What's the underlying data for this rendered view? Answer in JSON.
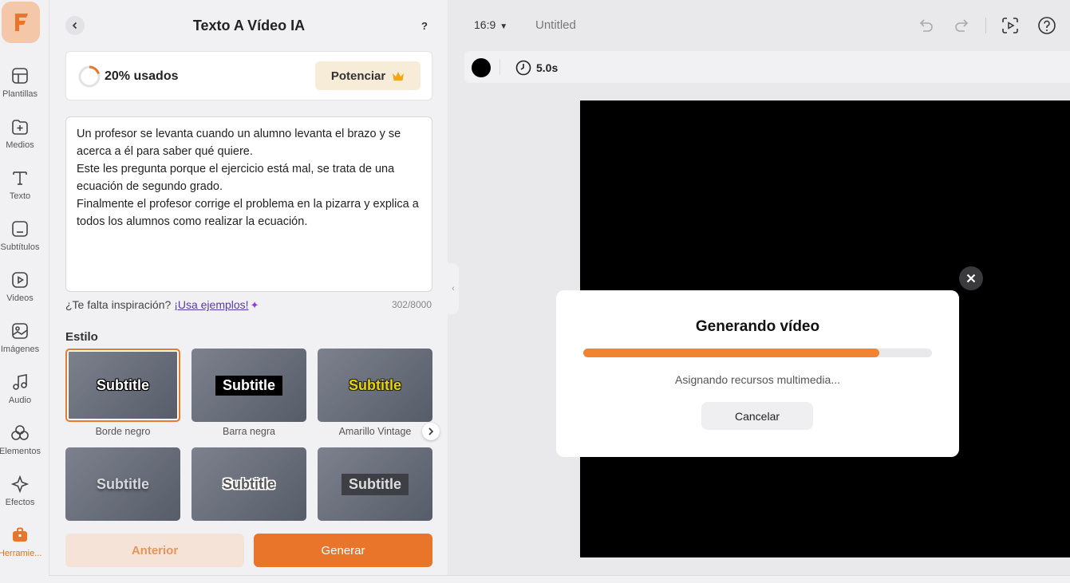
{
  "nav": {
    "items": [
      {
        "label": "Plantillas",
        "icon": "templates-icon"
      },
      {
        "label": "Medios",
        "icon": "media-icon"
      },
      {
        "label": "Texto",
        "icon": "text-icon"
      },
      {
        "label": "Subtítulos",
        "icon": "subtitles-icon"
      },
      {
        "label": "Videos",
        "icon": "videos-icon"
      },
      {
        "label": "Imágenes",
        "icon": "images-icon"
      },
      {
        "label": "Audio",
        "icon": "audio-icon"
      },
      {
        "label": "Elementos",
        "icon": "elements-icon"
      },
      {
        "label": "Efectos",
        "icon": "effects-icon"
      },
      {
        "label": "Herramie...",
        "icon": "tools-icon"
      }
    ]
  },
  "panel": {
    "title": "Texto A Vídeo IA",
    "help": "?",
    "usage": {
      "percent": 20,
      "label": "20% usados"
    },
    "upgrade_label": "Potenciar",
    "prompt_text": "Un profesor se levanta cuando un alumno levanta el brazo y se acerca a él para saber qué quiere.\nEste les pregunta porque el ejercicio está mal, se trata de una ecuación de segundo grado.\nFinalmente el profesor corrige el problema en la pizarra y explica a todos los alumnos como realizar la ecuación.",
    "inspiration_text": "¿Te falta inspiración?",
    "examples_link": "¡Usa ejemplos!",
    "char_count": "302/8000",
    "style_label": "Estilo",
    "styles": [
      {
        "preview": "Subtitle",
        "name": "Borde negro"
      },
      {
        "preview": "Subtitle",
        "name": "Barra negra"
      },
      {
        "preview": "Subtitle",
        "name": "Amarillo Vintage"
      },
      {
        "preview": "Subtitle",
        "name": ""
      },
      {
        "preview": "Subtitle",
        "name": ""
      },
      {
        "preview": "Subtitle",
        "name": ""
      }
    ],
    "prev_label": "Anterior",
    "generate_label": "Generar"
  },
  "topbar": {
    "ratio": "16:9",
    "doc_title": "Untitled"
  },
  "clip": {
    "duration": "5.0s",
    "bg_color": "#000000"
  },
  "modal": {
    "title": "Generando vídeo",
    "progress": 0.85,
    "status": "Asignando recursos multimedia...",
    "cancel_label": "Cancelar"
  },
  "colors": {
    "accent": "#e8752a",
    "progress": "#f08432"
  }
}
